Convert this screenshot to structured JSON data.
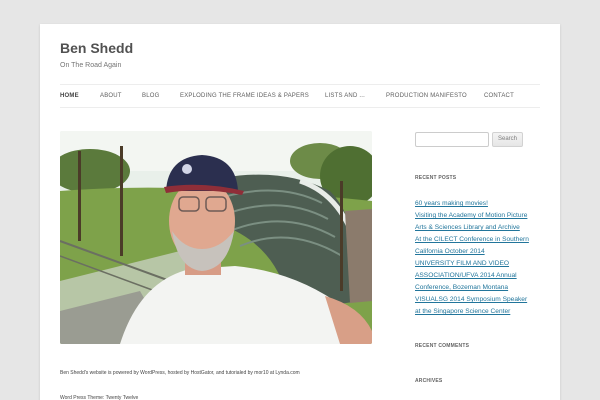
{
  "site": {
    "title": "Ben Shedd",
    "description": "On The Road Again"
  },
  "nav": {
    "items": [
      {
        "label": "HOME"
      },
      {
        "label": "ABOUT"
      },
      {
        "label": "BLOG"
      },
      {
        "label": "EXPLODING THE FRAME IDEAS & PAPERS"
      },
      {
        "label": "LISTS AND ..."
      },
      {
        "label": "PRODUCTION MANIFESTO"
      },
      {
        "label": "CONTACT"
      }
    ]
  },
  "search": {
    "placeholder": "",
    "button_label": "Search"
  },
  "widgets": {
    "recent_posts_title": "RECENT POSTS",
    "recent_posts": [
      "60 years making movies!",
      "Visiting the Academy of Motion Picture",
      "Arts & Sciences Library and Archive",
      "At the CILECT Conference in Southern",
      "California October 2014",
      "UNIVERSITY FILM AND VIDEO",
      "ASSOCIATION/UFVA 2014 Annual",
      "Conference, Bozeman Montana",
      "VISUALSG 2014 Symposium Speaker",
      "at the Singapore Science Center"
    ],
    "recent_comments_title": "RECENT COMMENTS",
    "archives_title": "ARCHIVES"
  },
  "footer": {
    "credit": "Ben Shedd's website is powered by WordPress, hosted by HostGator, and tutorialed by mor10 at Lynda.com",
    "theme": "Word Press Theme: Twenty Twelve"
  },
  "colors": {
    "background": "#e6e6e6",
    "link": "#21759b"
  }
}
